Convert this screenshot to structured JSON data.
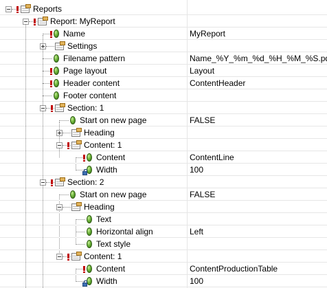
{
  "tree": {
    "rows": [
      {
        "name": "reports",
        "label": "Reports",
        "value": ""
      },
      {
        "name": "report-myreport",
        "label": "Report: MyReport",
        "value": ""
      },
      {
        "name": "prop-name",
        "label": "Name",
        "value": "MyReport"
      },
      {
        "name": "settings",
        "label": "Settings",
        "value": ""
      },
      {
        "name": "prop-filename-pattern",
        "label": "Filename pattern",
        "value": "Name_%Y_%m_%d_%H_%M_%S.pdf"
      },
      {
        "name": "prop-page-layout",
        "label": "Page layout",
        "value": "Layout"
      },
      {
        "name": "prop-header-content",
        "label": "Header content",
        "value": "ContentHeader"
      },
      {
        "name": "prop-footer-content",
        "label": "Footer content",
        "value": ""
      },
      {
        "name": "section-1",
        "label": "Section: 1",
        "value": ""
      },
      {
        "name": "prop-start-new-page-1",
        "label": "Start on new page",
        "value": "FALSE"
      },
      {
        "name": "heading-1",
        "label": "Heading",
        "value": ""
      },
      {
        "name": "content-1",
        "label": "Content: 1",
        "value": ""
      },
      {
        "name": "prop-content-1",
        "label": "Content",
        "value": "ContentLine"
      },
      {
        "name": "prop-width-1",
        "label": "Width",
        "value": "100"
      },
      {
        "name": "section-2",
        "label": "Section: 2",
        "value": ""
      },
      {
        "name": "prop-start-new-page-2",
        "label": "Start on new page",
        "value": "FALSE"
      },
      {
        "name": "heading-2",
        "label": "Heading",
        "value": ""
      },
      {
        "name": "prop-text",
        "label": "Text",
        "value": ""
      },
      {
        "name": "prop-horizontal-align",
        "label": "Horizontal align",
        "value": "Left"
      },
      {
        "name": "prop-text-style",
        "label": "Text style",
        "value": ""
      },
      {
        "name": "content-2",
        "label": "Content: 1",
        "value": ""
      },
      {
        "name": "prop-content-2",
        "label": "Content",
        "value": "ContentProductionTable"
      },
      {
        "name": "prop-width-2",
        "label": "Width",
        "value": "100"
      }
    ]
  },
  "icons": {
    "node": "folder-icon",
    "property": "bullet-icon",
    "required": "warning-icon",
    "locked": "lock-icon"
  },
  "colors": {
    "folder_tab": "#e1b35a",
    "bullet": "#6db43a",
    "required_marker": "#c00000",
    "row_border": "#e6e6e6"
  }
}
